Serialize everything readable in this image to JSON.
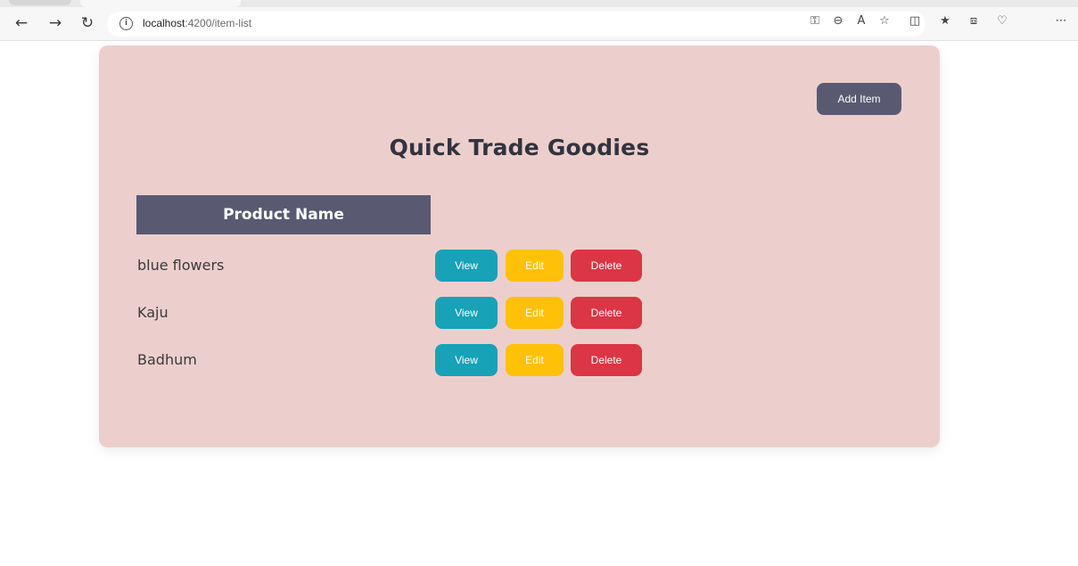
{
  "browser": {
    "url_host": "localhost",
    "url_path": ":4200/item-list"
  },
  "page": {
    "add_button_label": "Add Item",
    "title": "Quick Trade Goodies",
    "table_header": "Product Name",
    "rows": [
      {
        "name": "blue flowers",
        "view": "View",
        "edit": "Edit",
        "delete": "Delete"
      },
      {
        "name": "Kaju",
        "view": "View",
        "edit": "Edit",
        "delete": "Delete"
      },
      {
        "name": "Badhum",
        "view": "View",
        "edit": "Edit",
        "delete": "Delete"
      }
    ]
  },
  "colors": {
    "card_bg": "#eccfcc",
    "primary_dark": "#595a72",
    "view": "#17a2b8",
    "edit": "#ffc107",
    "delete": "#dc3545"
  },
  "icons": {
    "back": "arrow-left-icon",
    "forward": "arrow-right-icon",
    "refresh": "refresh-icon",
    "site_info": "info-icon",
    "toolbar": [
      "key-icon",
      "zoom-out-icon",
      "read-aloud-icon",
      "favorite-star-icon",
      "split-screen-icon",
      "favorites-list-icon",
      "collections-icon",
      "extensions-icon",
      "more-icon"
    ]
  }
}
